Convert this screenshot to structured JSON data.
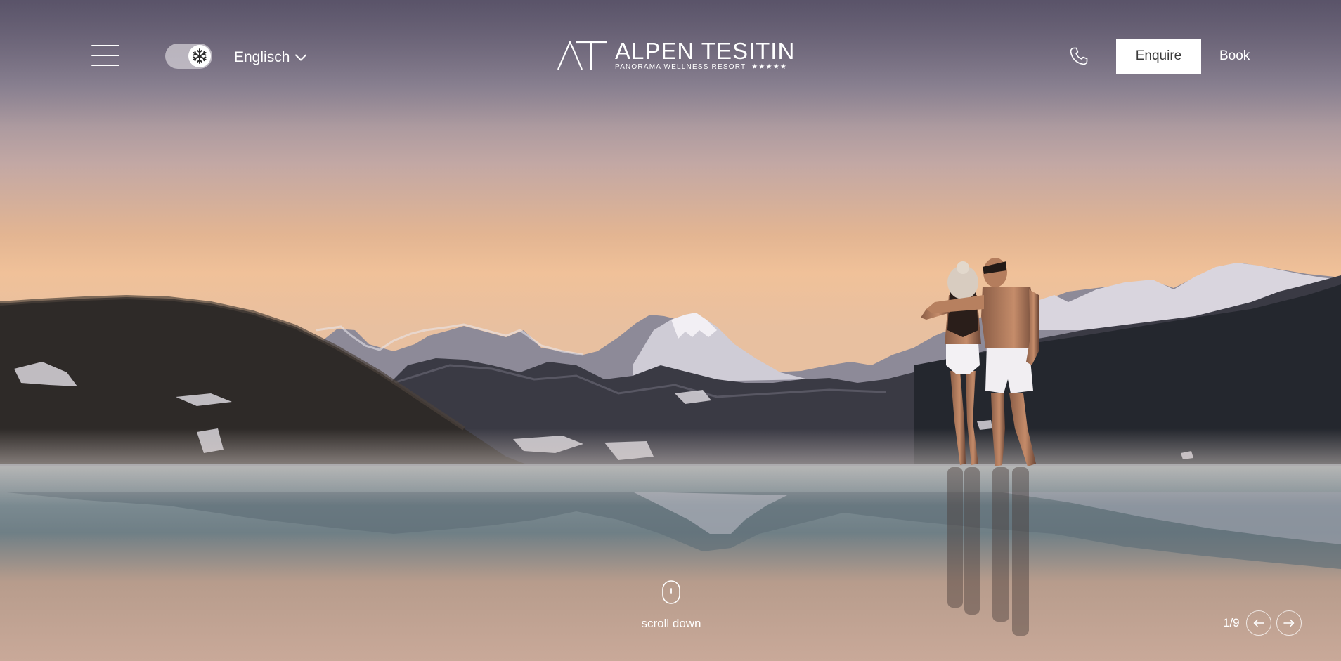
{
  "header": {
    "menu_icon": "hamburger-menu-icon",
    "season_toggle": {
      "icon": "snowflake-icon",
      "state": "winter"
    },
    "language": {
      "selected": "Englisch",
      "icon": "chevron-down-icon"
    },
    "logo": {
      "mark": "AT",
      "name": "ALPEN TESITIN",
      "subtitle": "PANORAMA WELLNESS RESORT",
      "stars": "★★★★★"
    },
    "phone_icon": "phone-icon",
    "enquire_label": "Enquire",
    "book_label": "Book"
  },
  "hero": {
    "scroll_icon": "mouse-icon",
    "scroll_label": "scroll down",
    "slide_counter": "1/9",
    "prev_icon": "arrow-left-icon",
    "next_icon": "arrow-right-icon"
  },
  "colors": {
    "sky_top": "#726b7f",
    "sky_glow": "#e8b88e",
    "mountains_dark": "#2a2a30",
    "snow": "#e6e4ea",
    "water": "#7e8a90",
    "button_bg": "#ffffff",
    "button_text": "#3a3a3a"
  }
}
